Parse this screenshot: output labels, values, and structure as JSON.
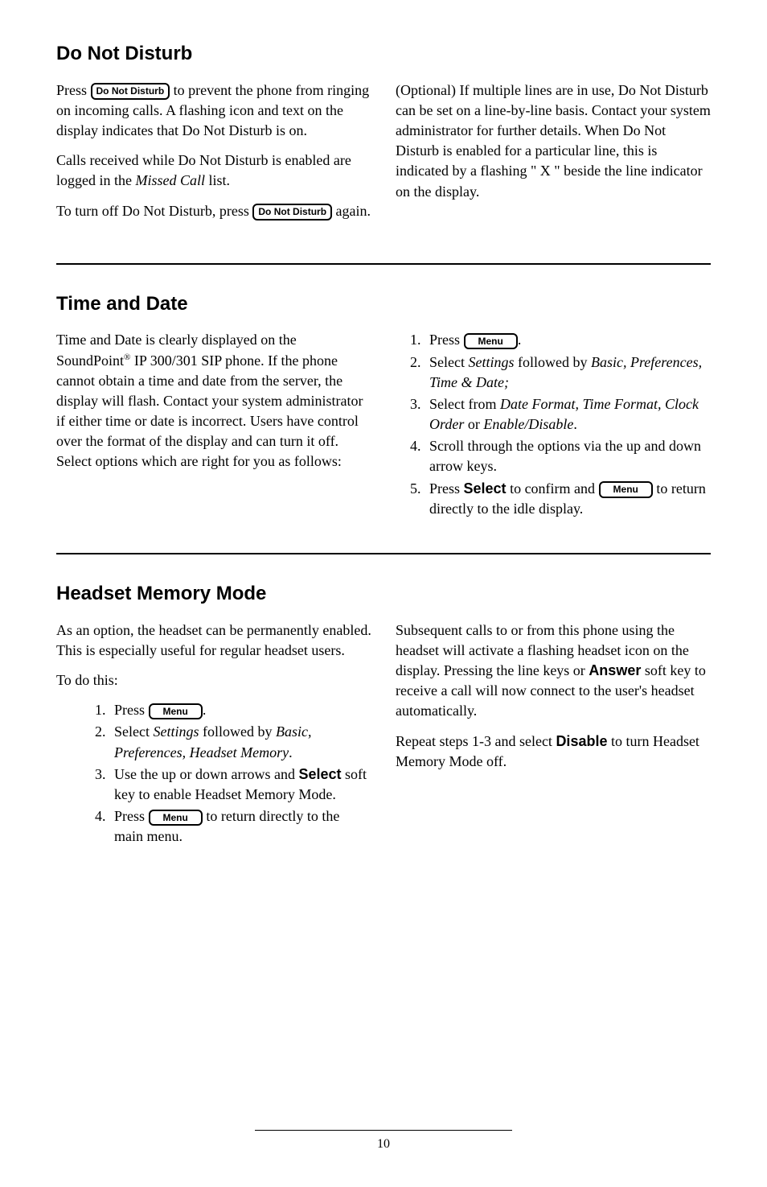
{
  "section1": {
    "heading": "Do Not Disturb",
    "p1a": "Press ",
    "btn1": "Do Not Disturb",
    "p1b": " to prevent the phone from ringing on incoming calls.  A flashing icon and text on the display indicates that Do Not Disturb is on.",
    "p2a": "Calls received while Do Not Disturb is enabled are logged in the ",
    "p2i": "Missed Call",
    "p2b": " list.",
    "p3a": "To turn off Do Not Disturb, press ",
    "btn2": "Do Not Disturb",
    "p3b": " again.",
    "right1": "(Optional) If multiple lines are in use, Do Not Disturb can be set on a line-by-line basis.  Contact your system administrator for further details.  When Do Not Disturb is enabled for a particular line, this is indicated by a flashing \" X \" beside the line indicator on the display."
  },
  "section2": {
    "heading": "Time and Date",
    "left1a": "Time and Date is clearly displayed on the SoundPoint",
    "left1sup": "®",
    "left1b": " IP 300/301 SIP phone.  If the phone cannot obtain a time and date from the server, the display will flash.  Contact your system administrator if either time or date is incorrect.  Users have control over the format of the display and can turn it off.  Select options which are right for you as follows:",
    "li1a": "Press ",
    "li1btn": "Menu",
    "li1b": ".",
    "li2a": "Select ",
    "li2i1": "Settings",
    "li2b": " followed by ",
    "li2i2": "Basic, Preferences, Time & Date;",
    "li3a": "Select from ",
    "li3i1": "Date Format, Time Format, Clock Order",
    "li3b": " or ",
    "li3i2": "Enable/Disable",
    "li3c": ".",
    "li4": "Scroll through the options via the up and down arrow keys.",
    "li5a": "Press ",
    "li5bold": "Select",
    "li5b": " to confirm and ",
    "li5btn": "Menu",
    "li5c": " to return directly to the idle display."
  },
  "section3": {
    "heading": "Headset Memory Mode",
    "left1": "As an option, the headset can be permanently enabled.  This is especially useful for regular headset users.",
    "left2": "To do this:",
    "li1a": "Press ",
    "li1btn": "Menu",
    "li1b": ".",
    "li2a": "Select ",
    "li2i1": "Settings",
    "li2b": " followed by ",
    "li2i2": "Basic, Preferences, Headset Memory",
    "li2c": ".",
    "li3a": "Use the up or down arrows and ",
    "li3bold": "Select",
    "li3b": " soft key to enable Headset Memory Mode.",
    "li4a": "Press ",
    "li4btn": "Menu",
    "li4b": " to return directly to the main menu.",
    "right1a": "Subsequent calls to or from this phone using the headset will activate a flashing headset icon on the display.  Pressing the line keys or ",
    "right1bold": "Answer",
    "right1b": " soft key to receive a call will now connect to the user's headset automatically.",
    "right2a": "Repeat steps 1-3 and select ",
    "right2bold": "Disable",
    "right2b": " to turn Headset Memory Mode off."
  },
  "pageNumber": "10"
}
